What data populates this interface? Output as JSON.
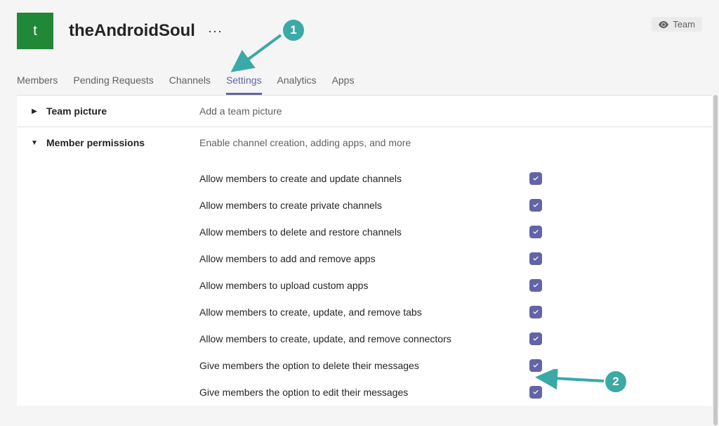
{
  "header": {
    "avatar_letter": "t",
    "team_name": "theAndroidSoul",
    "more_glyph": "···",
    "badge_label": "Team"
  },
  "tabs": [
    {
      "label": "Members",
      "active": false
    },
    {
      "label": "Pending Requests",
      "active": false
    },
    {
      "label": "Channels",
      "active": false
    },
    {
      "label": "Settings",
      "active": true
    },
    {
      "label": "Analytics",
      "active": false
    },
    {
      "label": "Apps",
      "active": false
    }
  ],
  "sections": {
    "team_picture": {
      "title": "Team picture",
      "desc": "Add a team picture"
    },
    "member_permissions": {
      "title": "Member permissions",
      "desc": "Enable channel creation, adding apps, and more",
      "items": [
        {
          "label": "Allow members to create and update channels",
          "checked": true
        },
        {
          "label": "Allow members to create private channels",
          "checked": true
        },
        {
          "label": "Allow members to delete and restore channels",
          "checked": true
        },
        {
          "label": "Allow members to add and remove apps",
          "checked": true
        },
        {
          "label": "Allow members to upload custom apps",
          "checked": true
        },
        {
          "label": "Allow members to create, update, and remove tabs",
          "checked": true
        },
        {
          "label": "Allow members to create, update, and remove connectors",
          "checked": true
        },
        {
          "label": "Give members the option to delete their messages",
          "checked": true
        },
        {
          "label": "Give members the option to edit their messages",
          "checked": true
        }
      ]
    }
  },
  "annotations": {
    "circle1": "1",
    "circle2": "2"
  }
}
